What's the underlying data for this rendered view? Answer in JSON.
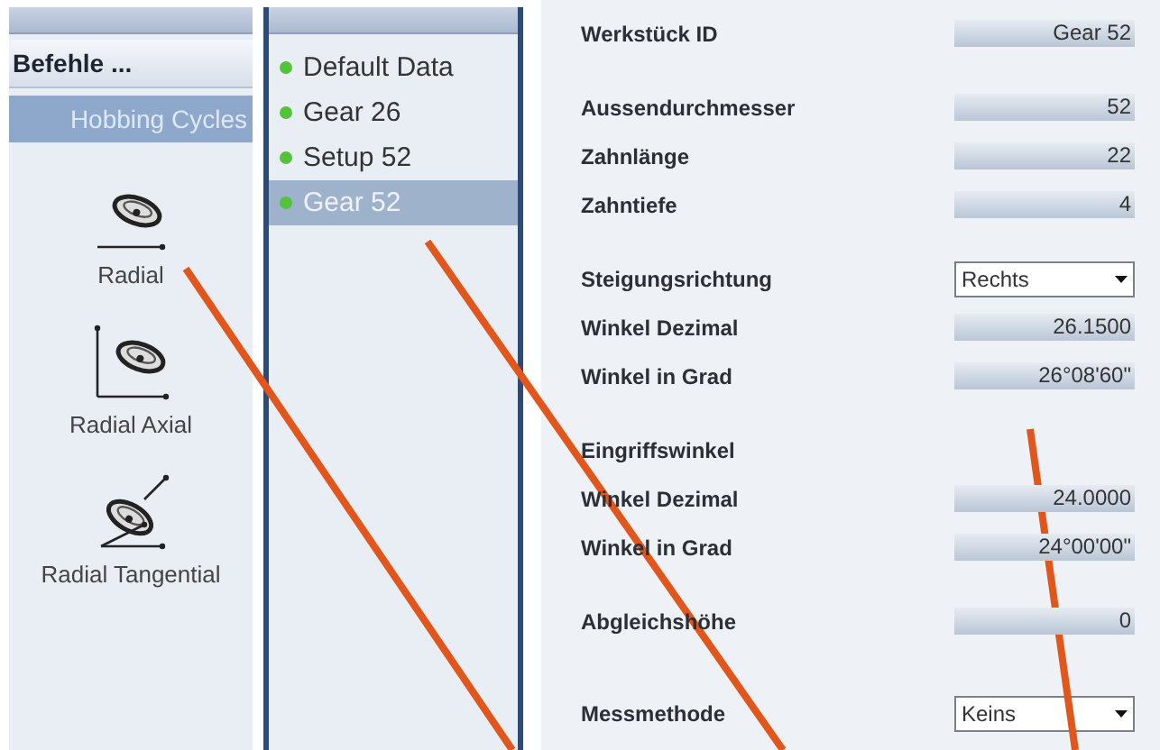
{
  "nav": {
    "commands": {
      "label": "Befehle ..."
    },
    "category": {
      "label": "Hobbing Cycles",
      "selected": true
    },
    "cycles": [
      {
        "label": "Radial",
        "kind": "radial"
      },
      {
        "label": "Radial Axial",
        "kind": "axial"
      },
      {
        "label": "Radial Tangential",
        "kind": "tangential"
      }
    ]
  },
  "datasets": {
    "items": [
      {
        "label": "Default Data",
        "selected": false
      },
      {
        "label": "Gear 26",
        "selected": false
      },
      {
        "label": "Setup 52",
        "selected": false
      },
      {
        "label": "Gear 52",
        "selected": true
      }
    ]
  },
  "form": {
    "groups": [
      {
        "rows": [
          {
            "kind": "field",
            "label": "Werkstück ID",
            "value": "Gear 52"
          }
        ]
      },
      {
        "rows": [
          {
            "kind": "field",
            "label": "Aussendurchmesser",
            "value": "52"
          },
          {
            "kind": "field",
            "label": "Zahnlänge",
            "value": "22"
          },
          {
            "kind": "field",
            "label": "Zahntiefe",
            "value": "4"
          }
        ]
      },
      {
        "rows": [
          {
            "kind": "dropdown",
            "label": "Steigungsrichtung",
            "value": "Rechts"
          },
          {
            "kind": "field",
            "label": "Winkel Dezimal",
            "value": "26.1500"
          },
          {
            "kind": "field",
            "label": "Winkel in Grad",
            "value": "26°08'60\""
          }
        ]
      },
      {
        "heading": "Eingriffswinkel",
        "rows": [
          {
            "kind": "field",
            "label": "Winkel Dezimal",
            "value": "24.0000"
          },
          {
            "kind": "field",
            "label": "Winkel in Grad",
            "value": "24°00'00\""
          }
        ]
      },
      {
        "rows": [
          {
            "kind": "field",
            "label": "Abgleichshöhe",
            "value": "0"
          }
        ]
      },
      {
        "rows": [
          {
            "kind": "dropdown",
            "label": "Messmethode",
            "value": "Keins"
          }
        ]
      }
    ]
  }
}
